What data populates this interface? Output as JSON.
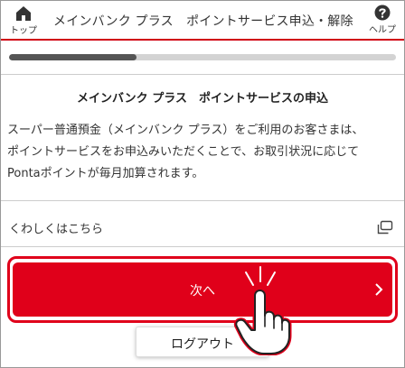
{
  "header": {
    "top_label": "トップ",
    "title": "メインバンク プラス　ポイントサービス申込・解除",
    "help_label": "ヘルプ",
    "top_icon": "home-icon",
    "help_icon": "help-icon"
  },
  "progress": {
    "fraction": 0.33
  },
  "main": {
    "section_title": "メインバンク プラス　ポイントサービスの申込",
    "description": [
      "スーパー普通預金（メインバンク プラス）をご利用のお客さまは、",
      "ポイントサービスをお申込みいただくことで、お取引状況に応じて",
      "Pontaポイントが毎月加算されます。"
    ],
    "more_link": "くわしくはこちら",
    "more_icon": "external-window-icon"
  },
  "buttons": {
    "next": "次へ",
    "logout": "ログアウト"
  },
  "colors": {
    "accent": "#e0001a",
    "progress": "#555555",
    "track": "#d3d3d3"
  }
}
